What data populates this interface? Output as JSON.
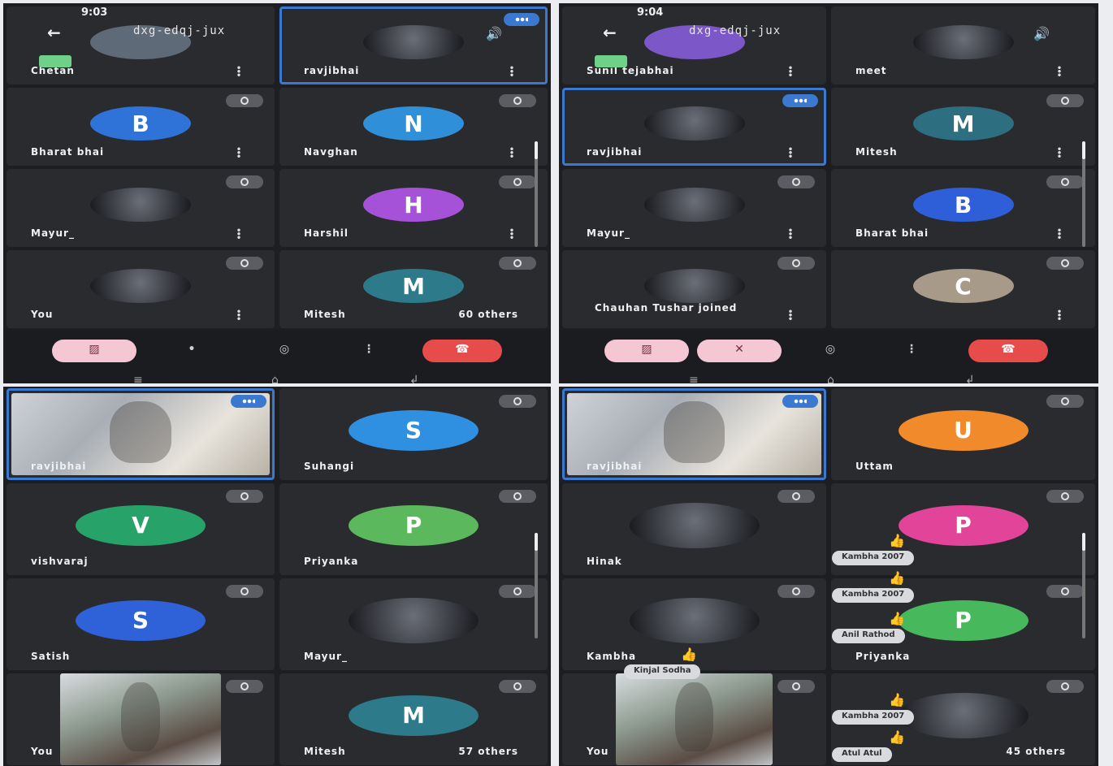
{
  "colors": {
    "blue": "#2f73d8",
    "teal": "#2d8a9a",
    "purple": "#a652d8",
    "green": "#27a36a",
    "lime": "#5cb85c",
    "orange": "#f08a2a",
    "pink": "#e2449a",
    "tan": "#bda98f",
    "pink_btn": "#f5c7d5",
    "end_red": "#e64c4c"
  },
  "screenshots": [
    {
      "time": "9:03",
      "meeting_code": "dxg-edqj-jux",
      "tiles": [
        {
          "name": "Chetan",
          "type": "avatar",
          "letter": "",
          "color": "#5e6a77"
        },
        {
          "name": "ravjibhai",
          "type": "photo",
          "active": true
        },
        {
          "name": "Bharat bhai",
          "type": "avatar",
          "letter": "B",
          "color": "#2f73d8"
        },
        {
          "name": "Navghan",
          "type": "avatar",
          "letter": "N",
          "color": "#2f8fd8"
        },
        {
          "name": "Mayur_",
          "type": "photo"
        },
        {
          "name": "Harshil",
          "type": "avatar",
          "letter": "H",
          "color": "#a652d8"
        },
        {
          "name": "You",
          "type": "photo"
        },
        {
          "name": "Mitesh",
          "type": "avatar",
          "letter": "M",
          "color": "#2d7a8a",
          "others": "60 others"
        }
      ]
    },
    {
      "time": "9:04",
      "meeting_code": "dxg-edqj-jux",
      "tiles": [
        {
          "name": "Sunil tejabhai",
          "type": "avatar",
          "letter": "",
          "color": "#7b57c8"
        },
        {
          "name": "meet",
          "type": "photo"
        },
        {
          "name": "ravjibhai",
          "type": "photo",
          "active": true
        },
        {
          "name": "Mitesh",
          "type": "avatar",
          "letter": "M",
          "color": "#2d6f80"
        },
        {
          "name": "Mayur_",
          "type": "photo"
        },
        {
          "name": "Bharat bhai",
          "type": "avatar",
          "letter": "B",
          "color": "#2f5fd8"
        },
        {
          "name": "",
          "type": "photo"
        },
        {
          "name": "",
          "type": "avatar",
          "letter": "C",
          "color": "#a89a88"
        }
      ],
      "toast": "Chauhan Tushar joined"
    },
    {
      "tiles": [
        {
          "name": "ravjibhai",
          "type": "video",
          "active": true
        },
        {
          "name": "Suhangi",
          "type": "avatar",
          "letter": "S",
          "color": "#2f8fe0"
        },
        {
          "name": "vishvaraj",
          "type": "avatar",
          "letter": "V",
          "color": "#27a36a"
        },
        {
          "name": "Priyanka",
          "type": "avatar",
          "letter": "P",
          "color": "#5cb85c"
        },
        {
          "name": "Satish",
          "type": "avatar",
          "letter": "S",
          "color": "#2f62d8"
        },
        {
          "name": "Mayur_",
          "type": "photo"
        },
        {
          "name": "You",
          "type": "video"
        },
        {
          "name": "Mitesh",
          "type": "avatar",
          "letter": "M",
          "color": "#2d7a8a",
          "others": "57 others"
        }
      ]
    },
    {
      "tiles": [
        {
          "name": "ravjibhai",
          "type": "video",
          "active": true
        },
        {
          "name": "Uttam",
          "type": "avatar",
          "letter": "U",
          "color": "#f08a2a"
        },
        {
          "name": "Hinak",
          "type": "photo"
        },
        {
          "name": "",
          "type": "avatar",
          "letter": "P",
          "color": "#e2449a"
        },
        {
          "name": "Kambha",
          "type": "photo"
        },
        {
          "name": "Priyanka",
          "type": "avatar",
          "letter": "P",
          "color": "#47b85c"
        },
        {
          "name": "You",
          "type": "video"
        },
        {
          "name": "",
          "type": "photo",
          "others": "45 others"
        }
      ],
      "reactions": [
        "Kambha 2007",
        "Kambha 2007",
        "Anil Rathod",
        "Kinjal Sodha",
        "Kambha 2007",
        "Atul Atul"
      ]
    }
  ]
}
